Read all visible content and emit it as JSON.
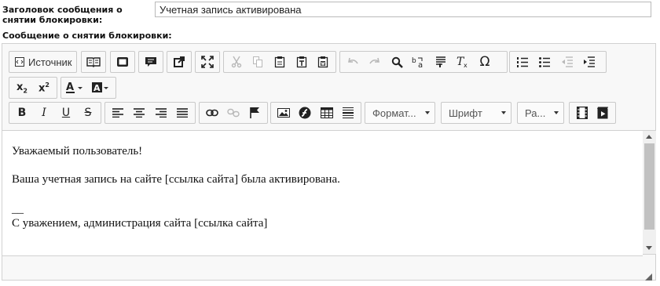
{
  "form": {
    "subject_label": "Заголовок сообщения о снятии блокировки:",
    "subject_value": "Учетная запись активирована",
    "message_label": "Сообщение о снятии блокировки:"
  },
  "toolbar": {
    "source_label": "Источник",
    "format_label": "Формат...",
    "font_label": "Шрифт",
    "size_label": "Ра..."
  },
  "content": {
    "greeting": "Уважаемый пользователь!",
    "body": "Ваша учетная запись на сайте [ссылка сайта] была активирована.",
    "separator": "__",
    "signature": "С уважением, администрация сайта [ссылка сайта]"
  },
  "icons": [
    "source-icon",
    "templates-icon",
    "preview-icon",
    "comment-icon",
    "external-link-icon",
    "maximize-icon",
    "cut-icon",
    "copy-icon",
    "paste-icon",
    "paste-text-icon",
    "paste-word-icon",
    "undo-icon",
    "redo-icon",
    "find-icon",
    "replace-icon",
    "select-all-icon",
    "remove-format-icon",
    "special-char-icon",
    "numbered-list-icon",
    "bulleted-list-icon",
    "outdent-icon",
    "indent-icon",
    "subscript-icon",
    "superscript-icon",
    "text-color-icon",
    "bg-color-icon",
    "bold-icon",
    "italic-icon",
    "underline-icon",
    "strike-icon",
    "align-left-icon",
    "align-center-icon",
    "align-right-icon",
    "justify-icon",
    "link-icon",
    "unlink-icon",
    "anchor-icon",
    "image-icon",
    "flash-icon",
    "table-icon",
    "horizontal-rule-icon",
    "video-icon",
    "media-icon"
  ]
}
